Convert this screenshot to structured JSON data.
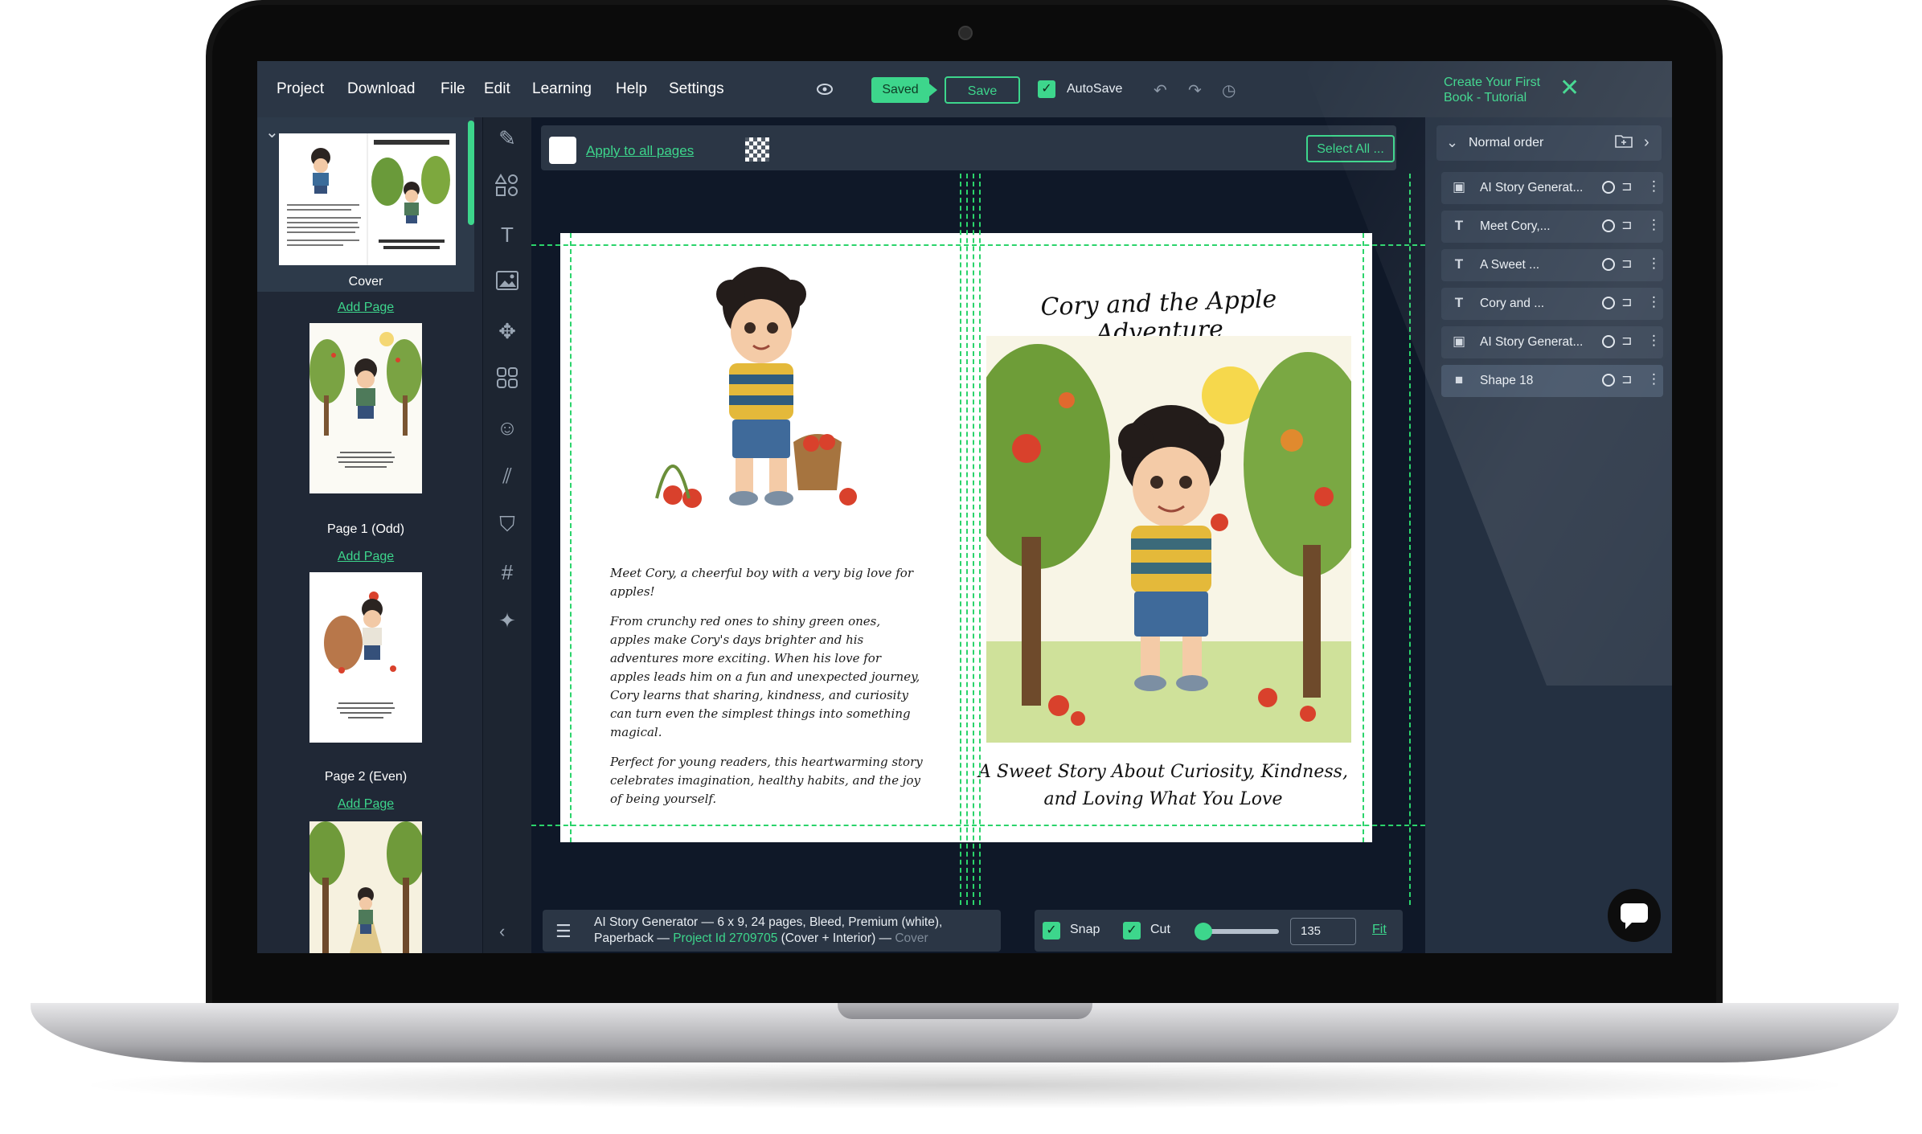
{
  "menu": [
    "Project",
    "Download",
    "File",
    "Edit",
    "Learning",
    "Help",
    "Settings"
  ],
  "toolbar": {
    "saved_label": "Saved",
    "save_label": "Save",
    "autosave_label": "AutoSave",
    "tutorial_label": "Create Your First Book - Tutorial"
  },
  "pages_panel": {
    "pages": [
      {
        "caption": "Cover"
      },
      {
        "caption": "Page 1 (Odd)"
      },
      {
        "caption": "Page 2 (Even)"
      }
    ],
    "add_page_label": "Add Page"
  },
  "options_bar": {
    "apply_label": "Apply to all pages",
    "select_all_label": "Select All ..."
  },
  "spread": {
    "story": [
      "Meet Cory, a cheerful boy with a very big love for apples!",
      "From crunchy red ones to shiny green ones, apples make Cory's days brighter and his adventures more exciting. When his love for apples leads him on a fun and unexpected journey, Cory learns that sharing, kindness, and curiosity can turn even the simplest things into something magical.",
      "Perfect for young readers, this heartwarming story celebrates imagination, healthy habits, and the joy of being yourself."
    ],
    "title": "Cory and the Apple Adventure",
    "subtitle": "A Sweet Story About Curiosity, Kindness, and Loving What You Love"
  },
  "info_bar": {
    "text_main": "AI Story Generator — 6 x 9, 24 pages, Bleed, Premium (white), Paperback — ",
    "project_id": "Project Id 2709705",
    "text_suffix": " (Cover + Interior) — ",
    "current": "Cover"
  },
  "snap_bar": {
    "snap_label": "Snap",
    "cut_label": "Cut",
    "zoom_value": "135",
    "zoom_fraction": 0.1,
    "fit_label": "Fit"
  },
  "layers_panel": {
    "order_label": "Normal order",
    "layers": [
      {
        "icon": "image-icon",
        "name": "AI Story Generat..."
      },
      {
        "icon": "text-icon",
        "name": "Meet Cory,..."
      },
      {
        "icon": "text-icon",
        "name": "A Sweet ..."
      },
      {
        "icon": "text-icon",
        "name": "Cory and ..."
      },
      {
        "icon": "image-icon",
        "name": "AI Story Generat..."
      },
      {
        "icon": "shape-icon",
        "name": "Shape 18"
      }
    ]
  },
  "colors": {
    "accent": "#3dd68c",
    "panel": "#2b3645",
    "canvas": "#0f1828"
  }
}
